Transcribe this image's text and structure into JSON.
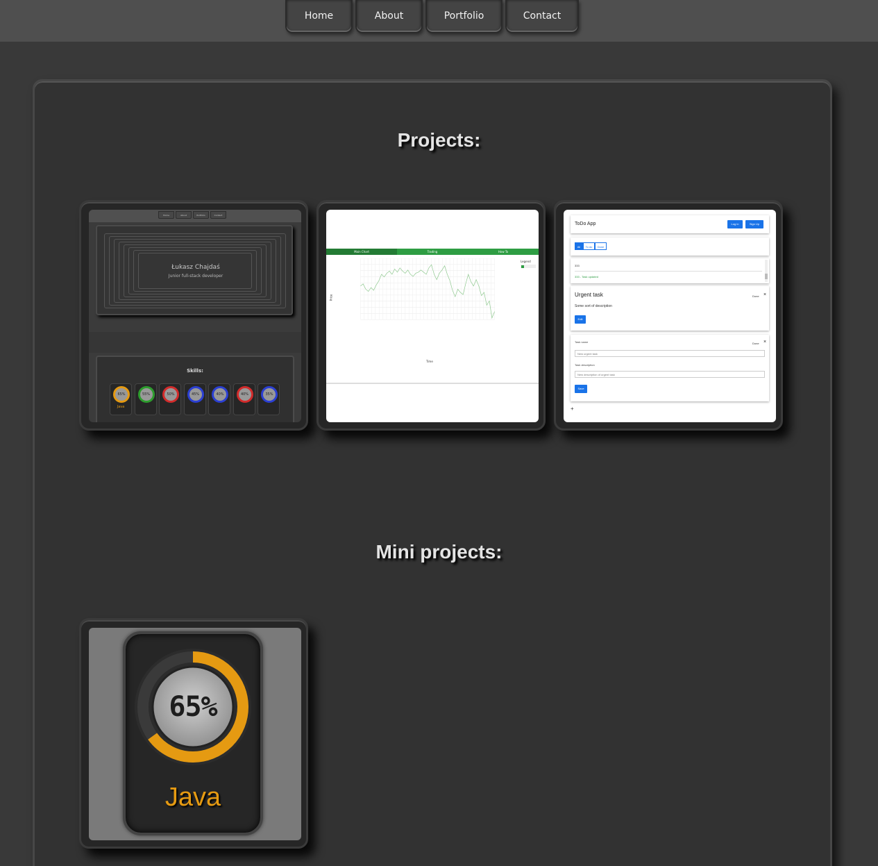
{
  "nav": {
    "items": [
      {
        "label": "Home"
      },
      {
        "label": "About"
      },
      {
        "label": "Portfolio"
      },
      {
        "label": "Contact"
      }
    ]
  },
  "sections": {
    "projects_title": "Projects:",
    "mini_projects_title": "Mini projects:"
  },
  "projects": {
    "portfolio_thumb": {
      "nav": [
        "Home",
        "About",
        "Portfolio",
        "Contact"
      ],
      "name": "Łukasz Chajdaś",
      "subtitle": "Junior full-stack developer",
      "skills_title": "Skills:",
      "skills": [
        {
          "percent": "65%",
          "color": "#e59a12"
        },
        {
          "percent": "55%",
          "color": "#2d9c2d"
        },
        {
          "percent": "50%",
          "color": "#d22b2b"
        },
        {
          "percent": "45%",
          "color": "#2b3fd2"
        },
        {
          "percent": "40%",
          "color": "#2b3fd2"
        },
        {
          "percent": "40%",
          "color": "#d22b2b"
        },
        {
          "percent": "35%",
          "color": "#2b3fd2"
        }
      ],
      "first_skill_label": "Java"
    },
    "chart_thumb": {
      "tabs": [
        "Main Chart",
        "Trading",
        "How To"
      ],
      "legend_title": "Legend",
      "x_axis_label": "Time",
      "y_axis_label": "Price",
      "line_color": "#8fc98f"
    },
    "todo_thumb": {
      "app_title": "ToDo App",
      "login_label": "Log in",
      "signup_label": "Sign Up",
      "filters": [
        "All",
        "To do",
        "Done"
      ],
      "list_items": [
        "333",
        "333 - Task updated"
      ],
      "task_name": "Urgent task",
      "task_description": "Some sort of description",
      "done_label": "Done",
      "edit_label": "Edit",
      "new_task_name_label": "Task name",
      "new_task_name_placeholder": "New urgent task",
      "new_task_desc_label": "Task description",
      "new_task_desc_placeholder": "New description of urgent task",
      "save_label": "Save",
      "add_label": "+"
    }
  },
  "mini_projects": {
    "gauge": {
      "value": "65%",
      "fraction": 0.65,
      "label": "Java",
      "color": "#e59a12"
    }
  }
}
